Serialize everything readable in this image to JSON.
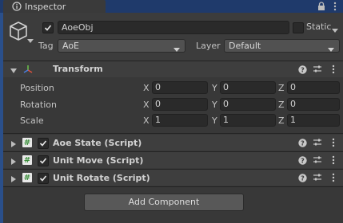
{
  "tab": {
    "title": "Inspector"
  },
  "object": {
    "name": "AoeObj",
    "static_label": "Static",
    "tag_label": "Tag",
    "tag_value": "AoE",
    "layer_label": "Layer",
    "layer_value": "Default"
  },
  "transform": {
    "title": "Transform",
    "rows": [
      {
        "label": "Position",
        "x": "0",
        "y": "0",
        "z": "0"
      },
      {
        "label": "Rotation",
        "x": "0",
        "y": "0",
        "z": "0"
      },
      {
        "label": "Scale",
        "x": "1",
        "y": "1",
        "z": "1"
      }
    ],
    "axis_labels": {
      "x": "X",
      "y": "Y",
      "z": "Z"
    }
  },
  "components": [
    {
      "title": "Aoe State (Script)",
      "enabled": true
    },
    {
      "title": "Unit Move (Script)",
      "enabled": true
    },
    {
      "title": "Unit Rotate (Script)",
      "enabled": true
    }
  ],
  "add_component_label": "Add Component",
  "script_glyph": "#",
  "colors": {
    "background": "#383838",
    "tab_bar": "#1f3a6b",
    "script_icon": "#3b8f3b"
  }
}
